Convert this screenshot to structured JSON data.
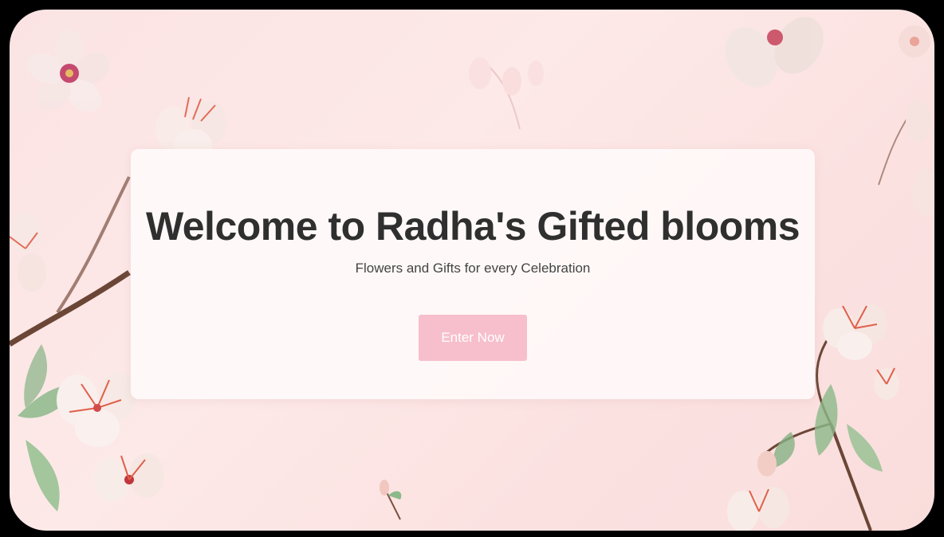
{
  "hero": {
    "title": "Welcome to Radha's Gifted blooms",
    "subtitle": "Flowers and Gifts for every Celebration",
    "cta_label": "Enter Now"
  },
  "colors": {
    "background": "#fbe3e3",
    "card": "#fffafa",
    "title_text": "#2f2f2f",
    "button": "#f7bfcc",
    "button_text": "#ffffff"
  },
  "decor": {
    "background_image": "blossom-branch-illustration"
  }
}
